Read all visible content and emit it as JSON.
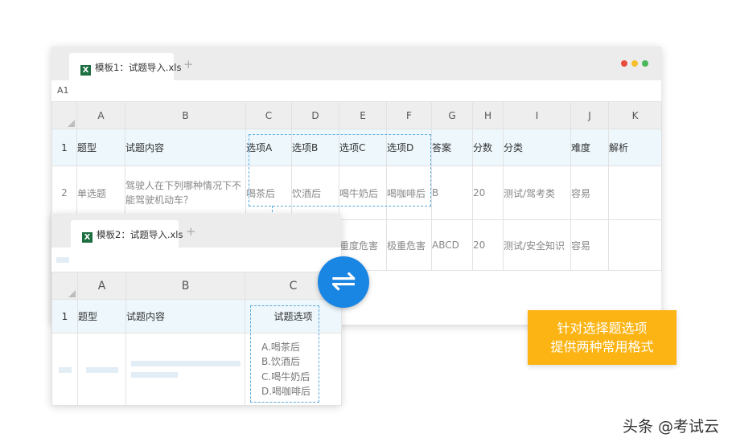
{
  "template1": {
    "tab_label": "模板1：试题导入.xls",
    "xls_icon_letter": "X",
    "add_tab": "+",
    "cell_ref": "A1",
    "columns": [
      "A",
      "B",
      "C",
      "D",
      "E",
      "F",
      "G",
      "H",
      "I",
      "J",
      "K"
    ],
    "header_row": {
      "num": "1",
      "cells": [
        "题型",
        "试题内容",
        "选项A",
        "选项B",
        "选项C",
        "选项D",
        "答案",
        "分数",
        "分类",
        "难度",
        "解析"
      ]
    },
    "row2": {
      "num": "2",
      "cells": [
        "单选题",
        "驾驶人在下列哪种情况下不能驾驶机动车？",
        "喝茶后",
        "饮酒后",
        "喝牛奶后",
        "喝咖啡后",
        "B",
        "20",
        "测试/驾考类",
        "容易",
        ""
      ]
    },
    "row3": {
      "cells": [
        "重度危害",
        "极重危害",
        "ABCD",
        "20",
        "测试/安全知识",
        "容易"
      ]
    }
  },
  "template2": {
    "tab_label": "模板2：试题导入.xls",
    "xls_icon_letter": "X",
    "add_tab": "+",
    "columns": [
      "A",
      "B",
      "C"
    ],
    "header_row": {
      "num": "1",
      "cells": [
        "题型",
        "试题内容",
        "试题选项"
      ]
    },
    "options": [
      "A.喝茶后",
      "B.饮酒后",
      "C.喝牛奶后",
      "D.喝咖啡后"
    ]
  },
  "window_dots": [
    "#e84c3d",
    "#f6c02c",
    "#4cb85c"
  ],
  "swap_icon": "swap-arrows-icon",
  "callout": {
    "line1": "针对选择题选项",
    "line2": "提供两种常用格式"
  },
  "watermark": "头条 @考试云",
  "colors": {
    "accent": "#1a86e3",
    "callout": "#fbb413",
    "header_bg": "#edf7fc"
  }
}
